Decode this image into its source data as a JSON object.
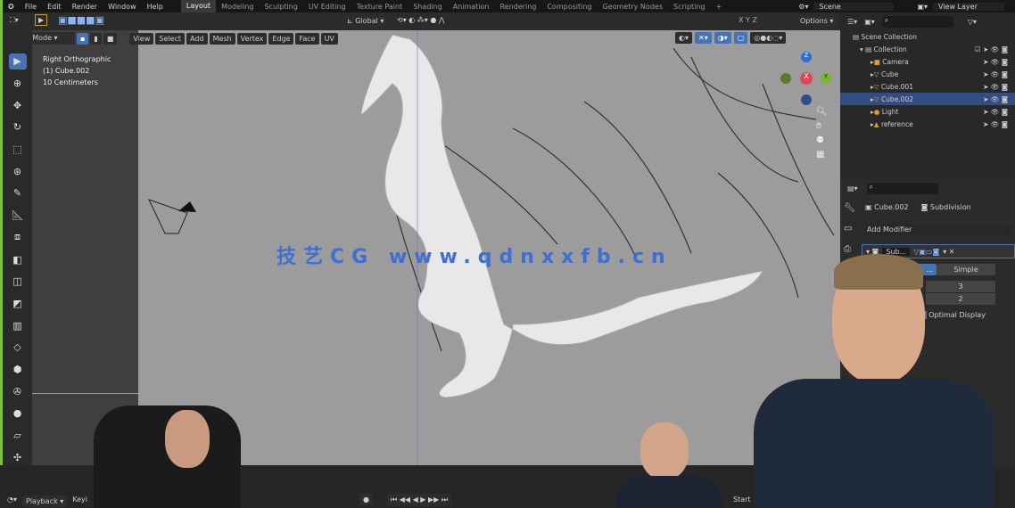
{
  "menu": {
    "items": [
      "File",
      "Edit",
      "Render",
      "Window",
      "Help"
    ],
    "workspaces": [
      "Layout",
      "Modeling",
      "Sculpting",
      "UV Editing",
      "Texture Paint",
      "Shading",
      "Animation",
      "Rendering",
      "Compositing",
      "Geometry Nodes",
      "Scripting",
      "+"
    ],
    "active_workspace": "Layout",
    "scene": "Scene",
    "view_layer": "View Layer"
  },
  "header": {
    "orientation": "Global",
    "axes": [
      "X",
      "Y",
      "Z"
    ],
    "options": "Options"
  },
  "modebar": {
    "mode": "Edit Mode",
    "menus": [
      "View",
      "Select",
      "Add",
      "Mesh",
      "Vertex",
      "Edge",
      "Face",
      "UV"
    ]
  },
  "viewport": {
    "info": [
      "Right Orthographic",
      "(1) Cube.002",
      "10 Centimeters"
    ],
    "gizmo": {
      "z": "Z",
      "x": "X",
      "y": "Y"
    }
  },
  "watermark": "技艺CG www.qdnxxfb.cn",
  "outliner": {
    "root": "Scene Collection",
    "collection": "Collection",
    "items": [
      {
        "name": "Camera",
        "selected": false
      },
      {
        "name": "Cube",
        "selected": false
      },
      {
        "name": "Cube.001",
        "selected": false
      },
      {
        "name": "Cube.002",
        "selected": true
      },
      {
        "name": "Light",
        "selected": false
      },
      {
        "name": "reference",
        "selected": false
      }
    ]
  },
  "properties": {
    "object": "Cube.002",
    "modifier_tab": "Subdivision",
    "add_modifier": "Add Modifier",
    "modifier_name": "Sub...",
    "tabs": [
      "...",
      "Simple"
    ],
    "levels_viewport": "3",
    "render": "2",
    "optimal_display": "Optimal Display",
    "optimal_checked": true
  },
  "timeline": {
    "playback": "Playback",
    "keying": "Keyi",
    "start": "Start"
  },
  "colors": {
    "accent": "#4772b3",
    "frame": "#7fbf3f",
    "watermark": "#3f6fd6"
  }
}
